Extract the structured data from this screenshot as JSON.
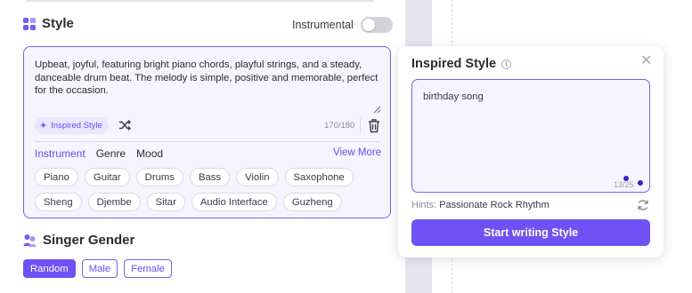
{
  "style_section": {
    "title": "Style",
    "instrumental_label": "Instrumental",
    "description": "Upbeat, joyful, featuring bright piano chords, playful strings, and a steady, danceable drum beat. The melody is simple, positive and memorable, perfect for the occasion.",
    "inspired_chip_label": "Inspired Style",
    "char_count": "170/180",
    "tabs": [
      "Instrument",
      "Genre",
      "Mood"
    ],
    "active_tab": "Instrument",
    "view_more": "View More",
    "instruments_row1": [
      "Piano",
      "Guitar",
      "Drums",
      "Bass",
      "Violin",
      "Saxophone"
    ],
    "instruments_row2": [
      "Sheng",
      "Djembe",
      "Sitar",
      "Audio Interface",
      "Guzheng"
    ]
  },
  "singer_section": {
    "title": "Singer Gender",
    "options": [
      "Random",
      "Male",
      "Female"
    ],
    "selected": "Random"
  },
  "popover": {
    "title": "Inspired Style",
    "input_value": "birthday song",
    "char_count": "13/25",
    "hints_label": "Hints:",
    "hints_value": "Passionate Rock Rhythm",
    "button_label": "Start writing Style"
  },
  "colors": {
    "accent": "#6f51f4",
    "border_accent": "#7b5cf5",
    "input_bg": "#f6f4fe"
  },
  "icons": [
    "grid-icon",
    "sparkle-icon",
    "shuffle-icon",
    "trash-icon",
    "person-icon",
    "info-icon",
    "close-icon",
    "refresh-icon"
  ]
}
